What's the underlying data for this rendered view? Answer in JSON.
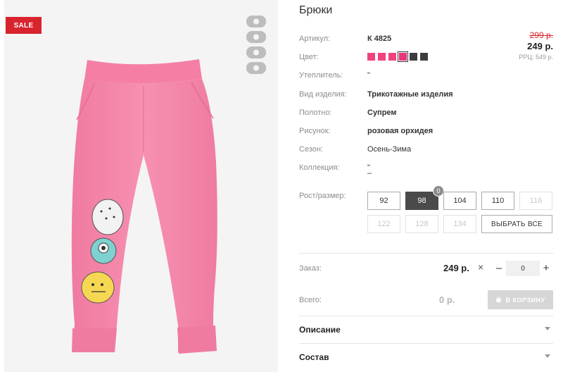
{
  "badge": {
    "sale": "SALE"
  },
  "product": {
    "title": "Брюки",
    "attributes": [
      {
        "label": "Артикул:",
        "value": "К 4825",
        "bold": true
      },
      {
        "label": "Цвет:",
        "value": "",
        "bold": false
      },
      {
        "label": "Утеплитель:",
        "value": "\"",
        "bold": false
      },
      {
        "label": "Вид изделия:",
        "value": "Трикотажные изделия",
        "bold": true
      },
      {
        "label": "Полотно:",
        "value": "Супрем",
        "bold": true
      },
      {
        "label": "Рисунок:",
        "value": "розовая орхидея",
        "bold": true
      },
      {
        "label": "Сезон:",
        "value": "Осень-Зима",
        "bold": false
      },
      {
        "label": "Коллекция:",
        "value": "\"",
        "bold": false
      }
    ],
    "collection_extra": "–",
    "colors": [
      "#f0427f",
      "#f0427f",
      "#f0427f",
      "#e8367a",
      "#3d3d3d",
      "#3d3d3d"
    ],
    "selected_color_index": 3
  },
  "pricing": {
    "old_price": "299 р.",
    "current_price": "249 р.",
    "rrp": "РРЦ: 549 р."
  },
  "sizes": {
    "label": "Рост/размер:",
    "options": [
      {
        "value": "92",
        "state": "normal"
      },
      {
        "value": "98",
        "state": "active"
      },
      {
        "value": "104",
        "state": "normal"
      },
      {
        "value": "110",
        "state": "normal"
      },
      {
        "value": "116",
        "state": "disabled"
      },
      {
        "value": "122",
        "state": "disabled"
      },
      {
        "value": "128",
        "state": "disabled"
      },
      {
        "value": "134",
        "state": "disabled"
      }
    ],
    "active_count": "0",
    "select_all_label": "ВЫБРАТЬ ВСЕ"
  },
  "order": {
    "label": "Заказ:",
    "price": "249 р.",
    "times": "×",
    "minus": "–",
    "quantity": "0",
    "plus": "+"
  },
  "total": {
    "label": "Всего:",
    "value": "0 р.",
    "cart_button": "В КОРЗИНУ"
  },
  "accordion": {
    "description": "Описание",
    "composition": "Состав"
  },
  "colors": {
    "sale_red": "#d8242e",
    "pants_pink": "#f48fae",
    "active_size": "#4a4a4a"
  }
}
